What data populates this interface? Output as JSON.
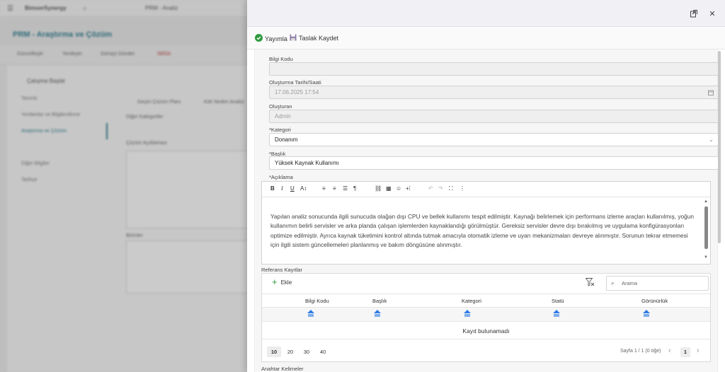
{
  "background": {
    "app_name": "BimserSynergy",
    "breadcrumb": "PRM - Analiz",
    "page_title": "PRM - Araştırma ve Çözüm",
    "toolbar": [
      "Güncelleştir",
      "Yenileyin",
      "Görüşü Gönder",
      "Sil/Gö"
    ],
    "tab_label": "Çalışma Başlat",
    "nav": [
      "Tanımlı",
      "Yordamlar ve Bilgilendirme",
      "Araştırma ve Çözüm",
      "Diğer Bilgiler",
      "Tarihçe"
    ],
    "tabs": [
      "Geçici Çözüm Planı",
      "Kök Neden Analizi"
    ],
    "fields": [
      "Diğer Kategoriler",
      "Çözüm Açıklaması",
      "Birimler"
    ]
  },
  "panel": {
    "actions": {
      "publish_label": "Yayımla",
      "draft_label": "Taslak Kaydet"
    },
    "form": {
      "info_code": {
        "label": "Bilgi Kodu",
        "value": ""
      },
      "created_date": {
        "label": "Oluşturma Tarihi/Saati",
        "value": "17.06.2025 17:54"
      },
      "created_by": {
        "label": "Oluşturan",
        "value": "Admin"
      },
      "category": {
        "label": "*Kategori",
        "value": "Donanım"
      },
      "title": {
        "label": "*Başlık",
        "value": "Yüksek Kaynak Kullanımı"
      },
      "description": {
        "label": "*Açıklama",
        "text": "Yapılan analiz sonucunda ilgili sunucuda olağan dışı CPU ve bellek kullanımı tespit edilmiştir. Kaynağı belirlemek için performans izleme araçları kullanılmış, yoğun kullanımın belirli servisler ve arka planda çalışan işlemlerden kaynaklandığı görülmüştür. Gereksiz servisler devre dışı bırakılmış ve uygulama konfigürasyonları optimize edilmiştir. Ayrıca kaynak tüketimini kontrol altında tutmak amacıyla otomatik izleme ve uyarı mekanizmaları devreye alınmıştır. Sorunun tekrar etmemesi için ilgili sistem güncellemeleri planlanmış ve bakım döngüsüne alınmıştır."
      },
      "references": {
        "label": "Referans Kayıtlar",
        "add_label": "Ekle",
        "search_placeholder": "Arama",
        "columns": [
          "Bilgi Kodu",
          "Başlık",
          "Kategori",
          "Statü",
          "Görünürlük"
        ],
        "empty_text": "Kayıt bulunamadı",
        "page_sizes": [
          "10",
          "20",
          "30",
          "40"
        ],
        "selected_page_size": "10",
        "page_info": "Sayfa 1 / 1 (0 öğe)",
        "current_page": "1"
      },
      "keywords": {
        "label": "Anahtar Kelimeler"
      }
    }
  },
  "colors": {
    "success": "#2e9a3e",
    "accent": "#2c7be5",
    "brand": "#2a7a8c"
  }
}
